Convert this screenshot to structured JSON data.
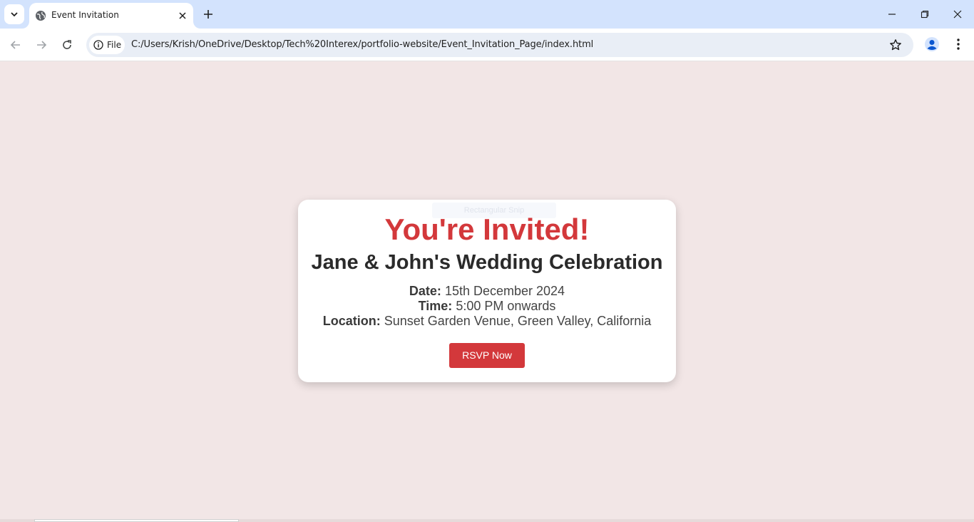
{
  "browser": {
    "tab": {
      "title": "Event Invitation"
    },
    "site_chip_label": "File",
    "url": "C:/Users/Krish/OneDrive/Desktop/Tech%20Interex/portfolio-website/Event_Invitation_Page/index.html"
  },
  "invitation": {
    "tooltip_ghost": "Rectangular Snip",
    "title": "You're Invited!",
    "subtitle": "Jane & John's Wedding Celebration",
    "details": [
      {
        "label": "Date:",
        "value": "15th December 2024"
      },
      {
        "label": "Time:",
        "value": "5:00 PM onwards"
      },
      {
        "label": "Location:",
        "value": "Sunset Garden Venue, Green Valley, California"
      }
    ],
    "rsvp_label": "RSVP Now"
  },
  "colors": {
    "page_background": "#f2e6e6",
    "accent_red": "#d3383b",
    "tabbar": "#d3e3fd"
  }
}
